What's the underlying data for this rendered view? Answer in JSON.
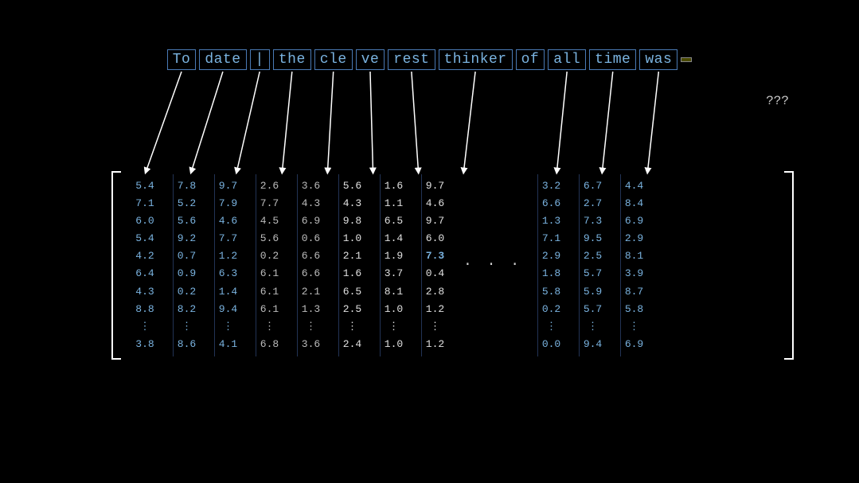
{
  "words": [
    {
      "id": "To",
      "label": "To",
      "masked": false
    },
    {
      "id": "date",
      "label": "date",
      "masked": false
    },
    {
      "id": "pipe",
      "label": "|",
      "masked": false
    },
    {
      "id": "the",
      "label": "the",
      "masked": false
    },
    {
      "id": "cle",
      "label": "cle",
      "masked": false
    },
    {
      "id": "ve",
      "label": "ve",
      "masked": false
    },
    {
      "id": "rest",
      "label": "rest",
      "masked": false
    },
    {
      "id": "thinker",
      "label": "thinker",
      "masked": false
    },
    {
      "id": "of",
      "label": "of",
      "masked": false
    },
    {
      "id": "all",
      "label": "all",
      "masked": false
    },
    {
      "id": "time",
      "label": "time",
      "masked": false
    },
    {
      "id": "was",
      "label": "was",
      "masked": false
    },
    {
      "id": "masked",
      "label": "",
      "masked": true
    }
  ],
  "question_marks": "???",
  "columns": [
    {
      "values": [
        "5.4",
        "7.1",
        "6.0",
        "5.4",
        "4.2",
        "6.4",
        "4.3",
        "8.8",
        "⋮",
        "3.8"
      ],
      "highlight": "blue"
    },
    {
      "values": [
        "7.8",
        "5.2",
        "5.6",
        "9.2",
        "0.7",
        "0.9",
        "0.2",
        "8.2",
        "⋮",
        "8.6"
      ],
      "highlight": "blue"
    },
    {
      "values": [
        "9.7",
        "7.9",
        "4.6",
        "7.7",
        "1.2",
        "6.3",
        "1.4",
        "9.4",
        "⋮",
        "4.1"
      ],
      "highlight": "blue"
    },
    {
      "values": [
        "2.6",
        "7.7",
        "4.5",
        "5.6",
        "0.2",
        "6.1",
        "6.1",
        "6.1",
        "⋮",
        "6.8"
      ],
      "highlight": "normal"
    },
    {
      "values": [
        "3.6",
        "4.3",
        "6.9",
        "0.6",
        "6.6",
        "6.6",
        "2.1",
        "1.3",
        "⋮",
        "3.6"
      ],
      "highlight": "normal"
    },
    {
      "values": [
        "5.6",
        "4.3",
        "9.8",
        "1.0",
        "2.1",
        "1.6",
        "6.5",
        "2.5",
        "⋮",
        "2.4"
      ],
      "highlight": "bold"
    },
    {
      "values": [
        "1.6",
        "1.1",
        "6.5",
        "1.4",
        "1.9",
        "3.7",
        "8.1",
        "1.0",
        "⋮",
        "1.0"
      ],
      "highlight": "bold"
    },
    {
      "values": [
        "9.7",
        "4.6",
        "9.7",
        "6.0",
        "7.3",
        "0.4",
        "2.8",
        "1.2",
        "⋮",
        "1.2"
      ],
      "highlight": "bold"
    },
    {
      "ellipsis": true
    },
    {
      "values": [
        "3.2",
        "6.6",
        "1.3",
        "7.1",
        "2.9",
        "1.8",
        "5.8",
        "0.2",
        "⋮",
        "0.0"
      ],
      "highlight": "blue"
    },
    {
      "values": [
        "6.7",
        "2.7",
        "7.3",
        "9.5",
        "2.5",
        "5.7",
        "5.9",
        "5.7",
        "⋮",
        "9.4"
      ],
      "highlight": "blue"
    },
    {
      "values": [
        "4.4",
        "8.4",
        "6.9",
        "2.9",
        "8.1",
        "3.9",
        "8.7",
        "5.8",
        "⋮",
        "6.9"
      ],
      "highlight": "blue"
    }
  ]
}
